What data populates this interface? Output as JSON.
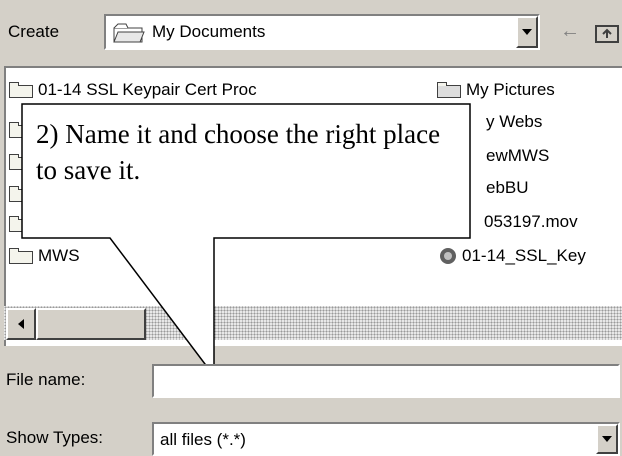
{
  "toolbar": {
    "create_label": "Create",
    "location_value": "My Documents"
  },
  "files": [
    {
      "name": "01-14 SSL Keypair Cert Proc",
      "icon": "folder-icon"
    },
    {
      "name": "MWS",
      "icon": "folder-icon"
    },
    {
      "name": "My Pictures",
      "icon": "pictures-folder-icon"
    },
    {
      "name": "y Webs",
      "icon": "folder-icon"
    },
    {
      "name": "ewMWS",
      "icon": "folder-icon"
    },
    {
      "name": "ebBU",
      "icon": "folder-icon"
    },
    {
      "name": "053197.mov",
      "icon": "movie-file-icon"
    },
    {
      "name": "01-14_SSL_Key",
      "icon": "document-icon"
    }
  ],
  "callout": {
    "text": "2) Name it and choose the right place to save it."
  },
  "filename": {
    "label": "File name:",
    "value": ""
  },
  "types": {
    "label": "Show Types:",
    "value": "all files (*.*)"
  }
}
